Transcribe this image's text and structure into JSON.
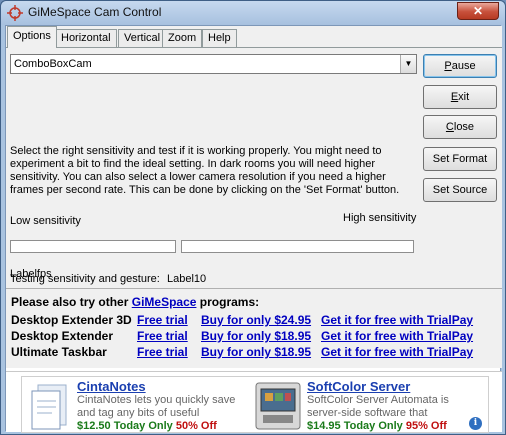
{
  "window": {
    "title": "GiMeSpace Cam Control",
    "close_label": "✕"
  },
  "tabs": [
    {
      "label": "Options",
      "active": true
    },
    {
      "label": "Horizontal",
      "active": false
    },
    {
      "label": "Vertical",
      "active": false
    },
    {
      "label": "Zoom",
      "active": false
    },
    {
      "label": "Help",
      "active": false
    }
  ],
  "options": {
    "camera_combo": "ComboBoxCam",
    "description": "Select the right sensitivity and test if it is working properly. You might need to experiment a bit to find the ideal setting. In dark rooms you will need higher sensitivity. You can also select a lower camera resolution if you need a higher frames per second rate. This can be done by clicking on the 'Set Format' button.",
    "low_sensitivity": "Low sensitivity",
    "high_sensitivity": "High sensitivity",
    "testing_label": "Testing sensitivity and gesture:",
    "testing_value": "Label10",
    "fps_label": "Labelfps"
  },
  "buttons": {
    "pause_prefix": "",
    "pause_mnemonic": "P",
    "pause_rest": "ause",
    "exit_prefix": "",
    "exit_mnemonic": "E",
    "exit_rest": "xit",
    "close_prefix": "",
    "close_mnemonic": "C",
    "close_rest": "lose",
    "set_format": "Set Format",
    "set_source": "Set Source"
  },
  "promo": {
    "heading_prefix": "Please also try other",
    "heading_link": "GiMeSpace",
    "heading_suffix": "programs:",
    "rows": [
      {
        "name": "Desktop Extender 3D",
        "trial": "Free trial",
        "buy": "Buy for only $24.95",
        "free": "Get it for free with TrialPay"
      },
      {
        "name": "Desktop Extender",
        "trial": "Free trial",
        "buy": "Buy for only $18.95",
        "free": "Get it for free with TrialPay"
      },
      {
        "name": "Ultimate Taskbar",
        "trial": "Free trial",
        "buy": "Buy for only $18.95",
        "free": "Get it for free with TrialPay"
      }
    ]
  },
  "ad": {
    "left": {
      "title": "CintaNotes",
      "text": "CintaNotes lets you quickly save and tag any bits of useful",
      "price": "$12.50 Today Only",
      "discount": "50% Off"
    },
    "right": {
      "title": "SoftColor Server",
      "text": "SoftColor Server Automata is server-side software that",
      "price": "$14.95 Today Only",
      "discount": "95% Off"
    },
    "info_label": "i"
  }
}
